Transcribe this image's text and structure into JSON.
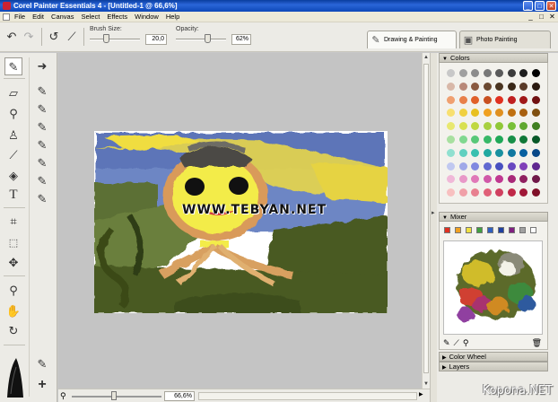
{
  "window": {
    "title": "Corel Painter Essentials 4 - [Untitled-1 @ 66,6%]",
    "buttons": {
      "minimize": "_",
      "maximize": "□",
      "close": "✕"
    }
  },
  "menu": {
    "items": [
      "File",
      "Edit",
      "Canvas",
      "Select",
      "Effects",
      "Window",
      "Help"
    ],
    "doc_controls": [
      "_",
      "□",
      "✕"
    ]
  },
  "toolbar": {
    "brush_size_label": "Brush Size:",
    "brush_size_value": "20,0",
    "opacity_label": "Opacity:",
    "opacity_value": "62%",
    "brush_size_level": 0.32,
    "opacity_level": 0.62
  },
  "tabs": [
    {
      "label": "Drawing & Painting",
      "active": true
    },
    {
      "label": "Photo Painting",
      "active": false
    }
  ],
  "tools": [
    "brush-icon",
    "eraser-icon",
    "dropper-icon",
    "stamp-icon",
    "picker-icon",
    "fill-icon",
    "text-icon",
    "crop-icon",
    "marquee-icon",
    "transform-icon",
    "magnifier-icon",
    "hand-icon",
    "rotate-icon"
  ],
  "canvas": {
    "watermark": "WWW.TEBYAN.NET"
  },
  "status": {
    "zoom": "66,6%"
  },
  "panels": {
    "colors_title": "Colors",
    "mixer_title": "Mixer",
    "color_wheel_title": "Color Wheel",
    "layers_title": "Layers"
  },
  "colors": {
    "swatches": [
      "#c8c8c8",
      "#a0a0a0",
      "#8c8c8c",
      "#787878",
      "#5a5a5a",
      "#3c3c3c",
      "#1e1e1e",
      "#000000",
      "#d8b8a8",
      "#b88878",
      "#8a5a40",
      "#6a4830",
      "#4a3420",
      "#3a2818",
      "#5a3a28",
      "#2a1a10",
      "#f0a070",
      "#e8804a",
      "#e0602a",
      "#c85020",
      "#e03020",
      "#c02020",
      "#a01818",
      "#701010",
      "#f8e070",
      "#f0d040",
      "#e8c020",
      "#f0a020",
      "#e09020",
      "#c07010",
      "#a86010",
      "#805010",
      "#e8e870",
      "#d8e050",
      "#c0d840",
      "#a8d040",
      "#90c838",
      "#78c038",
      "#60a830",
      "#408020",
      "#a8e0a0",
      "#80d890",
      "#58c878",
      "#38b868",
      "#20a858",
      "#189048",
      "#107838",
      "#085828",
      "#90e0d0",
      "#60d0c0",
      "#38c0b0",
      "#20a8a0",
      "#1890a0",
      "#1078a0",
      "#0860a0",
      "#084888",
      "#c0c8f0",
      "#a0a8e8",
      "#8088e0",
      "#6068d0",
      "#4850c0",
      "#6848c0",
      "#8040b8",
      "#602890",
      "#f0b8d8",
      "#e898c8",
      "#e078b8",
      "#d058a8",
      "#c03890",
      "#a82878",
      "#902060",
      "#701848",
      "#f8c0c0",
      "#f0a0a8",
      "#e88090",
      "#e06078",
      "#d04060",
      "#c02848",
      "#a01838",
      "#801028"
    ]
  },
  "mixer": {
    "swatches": [
      "#e03020",
      "#f0a020",
      "#f0e040",
      "#40a040",
      "#3060c0",
      "#2040a0",
      "#802080",
      "#a0a0a0",
      "#ffffff"
    ]
  },
  "footer": {
    "brand": "Kopona.NET"
  }
}
